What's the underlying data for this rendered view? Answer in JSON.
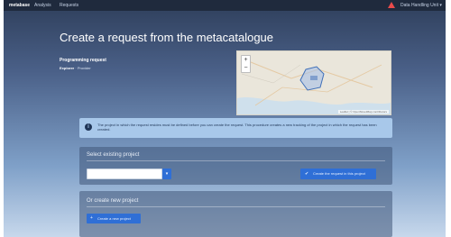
{
  "nav": {
    "brand": "metabase",
    "links": [
      "Analysis",
      "Requests"
    ],
    "alert_icon": "warning-icon",
    "user": "Data Handling Unit ▾"
  },
  "page": {
    "title": "Create a request from the metacatalogue"
  },
  "request": {
    "name": "Programming request",
    "meta_label": "Explorer",
    "meta_value": "Provider"
  },
  "map": {
    "zoom_in": "+",
    "zoom_out": "−",
    "attribution": "Leaflet | © OpenStreetMap contributors"
  },
  "alert": {
    "icon": "info-icon",
    "text": "The project in which the request resides must be defined before you can create the request. This procedure creates a new tracking of the project in which the request has been created."
  },
  "existing": {
    "heading": "Select existing project",
    "select_value": "",
    "link_button": "Create the request in this project"
  },
  "new_project": {
    "heading": "Or create new project",
    "create_button": "Create a new project"
  },
  "colors": {
    "primary": "#2f6fd6",
    "alert_bg": "#a8c8ea",
    "topbar": "#1f2a3d"
  }
}
